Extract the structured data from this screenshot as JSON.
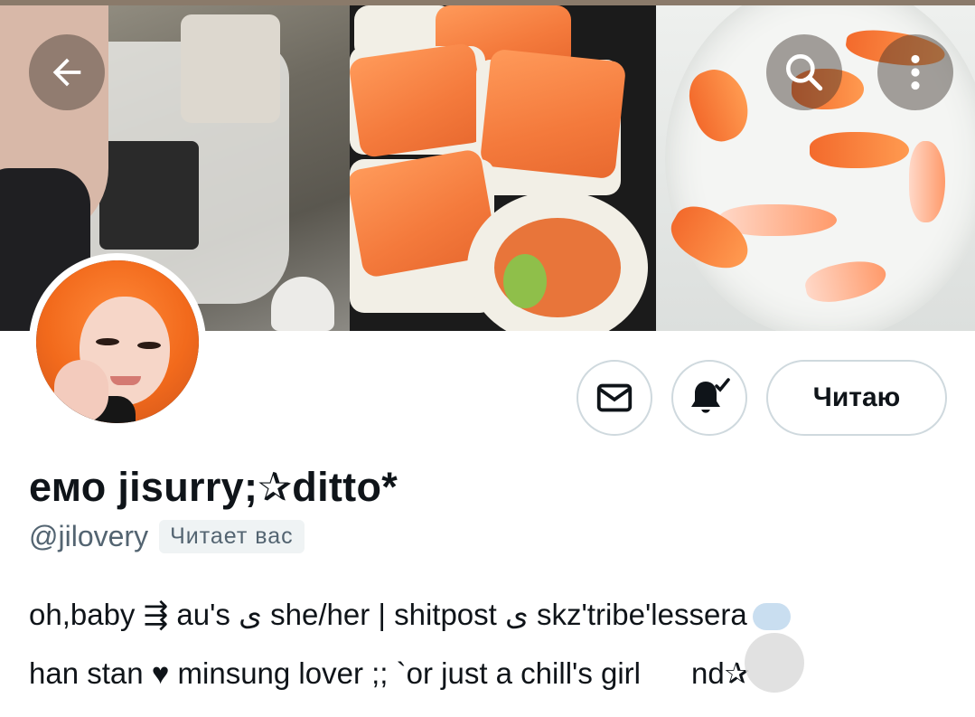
{
  "profile": {
    "display_name": "емо jisurry;✰ditto*",
    "handle": "@jilovery",
    "follows_you_badge": "Читает вас",
    "follow_button_label": "Читаю",
    "bio_line1": "oh,baby ⇶ au's ﻯ she/her | shitpost ﻯ skz'tribe'lessera",
    "bio_line2": "han stan ♥ minsung lover ;; `or just a chill's girl",
    "bio_line2_tail": "nd✰"
  },
  "icons": {
    "back": "arrow-left-icon",
    "search": "search-icon",
    "more": "more-vertical-icon",
    "message": "envelope-icon",
    "notifications": "bell-check-icon",
    "bio_emoji": "thought-cloud-icon"
  },
  "colors": {
    "text_primary": "#0f1419",
    "text_secondary": "#536471",
    "button_border": "#cfd9de",
    "badge_bg": "#eff3f4"
  }
}
